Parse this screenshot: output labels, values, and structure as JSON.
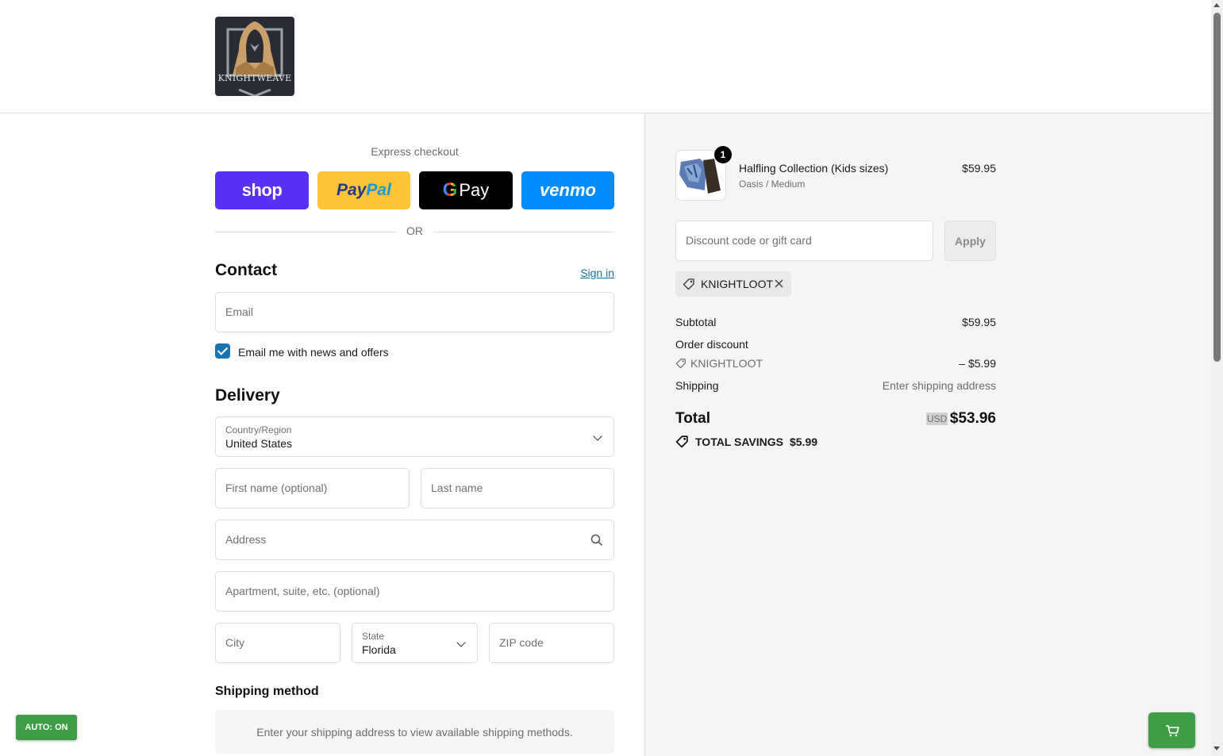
{
  "brand": {
    "logo_text": "KNIGHTWEAVE"
  },
  "express": {
    "label": "Express checkout",
    "shop_label": "shop",
    "paypal_part1": "Pay",
    "paypal_part2": "Pal",
    "gpay_g": "G",
    "gpay_label": "Pay",
    "venmo_label": "venmo",
    "or_label": "OR"
  },
  "contact": {
    "title": "Contact",
    "signin_label": "Sign in",
    "email_placeholder": "Email",
    "newsletter_label": "Email me with news and offers",
    "newsletter_checked": true
  },
  "delivery": {
    "title": "Delivery",
    "country_label": "Country/Region",
    "country_value": "United States",
    "first_name_placeholder": "First name (optional)",
    "last_name_placeholder": "Last name",
    "address_placeholder": "Address",
    "apartment_placeholder": "Apartment, suite, etc. (optional)",
    "city_placeholder": "City",
    "state_label": "State",
    "state_value": "Florida",
    "zip_placeholder": "ZIP code"
  },
  "shipping_method": {
    "title": "Shipping method",
    "message": "Enter your shipping address to view available shipping methods."
  },
  "summary": {
    "item": {
      "name": "Halfling Collection (Kids sizes)",
      "variant": "Oasis / Medium",
      "price": "$59.95",
      "quantity": "1"
    },
    "discount_placeholder": "Discount code or gift card",
    "apply_label": "Apply",
    "applied_code": "KNIGHTLOOT",
    "subtotal_label": "Subtotal",
    "subtotal_value": "$59.95",
    "order_discount_label": "Order discount",
    "discount_code": "KNIGHTLOOT",
    "discount_value": "– $5.99",
    "shipping_label": "Shipping",
    "shipping_value": "Enter shipping address",
    "total_label": "Total",
    "currency": "USD",
    "total_value": "$53.96",
    "savings_label": "TOTAL SAVINGS",
    "savings_value": "$5.99"
  },
  "overlay": {
    "auto_label": "AUTO: ON"
  },
  "colors": {
    "accent": "#1773b0",
    "shop": "#5a31f4",
    "paypal": "#ffc439",
    "gpay": "#000000",
    "venmo": "#008cff",
    "auto_green": "#3e9d46"
  }
}
